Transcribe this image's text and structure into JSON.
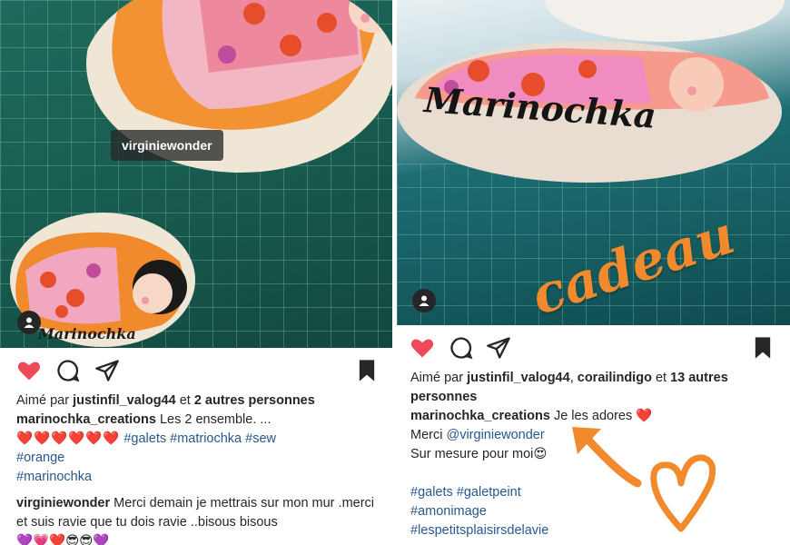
{
  "left": {
    "photo_tag": "virginiewonder",
    "stone_text": "Marinochka",
    "liked_prefix": "Aimé par",
    "liked_user": "justinfil_valog44",
    "liked_and": "et",
    "liked_others": "2 autres personnes",
    "caption_user": "marinochka_creations",
    "caption_text": "Les 2 ensemble. ...",
    "hearts": "❤️❤️❤️❤️❤️❤️",
    "tags_line1": "#galets #matriochka #sew",
    "tags_line2": "#orange",
    "tags_line3": "#marinochka",
    "comment_user": "virginiewonder",
    "comment_text": "Merci demain je mettrais sur mon mur .merci et suis ravie que tu dois ravie ..bisous bisous",
    "comment_emojis": "💜💗❤️😎😎💜"
  },
  "right": {
    "stone_text": "Marinochka",
    "script_text": "cadeau",
    "liked_prefix": "Aimé par",
    "liked_user1": "justinfil_valog44",
    "liked_sep": ",",
    "liked_user2": "corailindigo",
    "liked_and": "et",
    "liked_others": "13 autres personnes",
    "caption_user": "marinochka_creations",
    "caption_text": "Je les adores ❤️",
    "merci": "Merci",
    "mention": "@virginiewonder",
    "sur_mesure": "Sur mesure pour moi😍",
    "tags_line1": "#galets #galetpeint",
    "tags_line2": "#amonimage",
    "tags_line3": "#lespetitsplaisirsdelavie"
  },
  "colors": {
    "heart": "#ed4956",
    "hashtag": "#27588f",
    "accent_orange": "#f08a2c"
  }
}
